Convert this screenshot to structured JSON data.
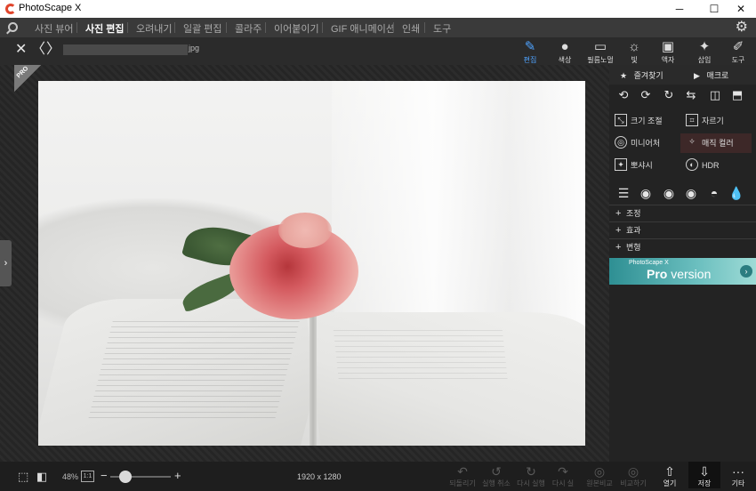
{
  "window": {
    "title": "PhotoScape X",
    "minimize": "─",
    "maximize": "☐",
    "close": "✕"
  },
  "menu": {
    "tabs": [
      "사진 뷰어",
      "사진 편집",
      "오려내기",
      "일괄 편집",
      "콜라주",
      "이어붙이기",
      "GIF 애니메이션",
      "인쇄",
      "도구"
    ],
    "active_index": 1
  },
  "nav": {
    "close": "✕",
    "prev": "〈",
    "next": "〉",
    "file_ext": "jpg"
  },
  "tools": [
    {
      "label": "편집",
      "icon": "edit-icon",
      "glyph": "✎",
      "active": true
    },
    {
      "label": "색상",
      "icon": "color-icon",
      "glyph": "●",
      "active": false
    },
    {
      "label": "필름노멀",
      "icon": "film-icon",
      "glyph": "▭",
      "active": false
    },
    {
      "label": "빛",
      "icon": "light-icon",
      "glyph": "☼",
      "active": false
    },
    {
      "label": "액자",
      "icon": "frame-icon",
      "glyph": "▣",
      "active": false
    },
    {
      "label": "삽입",
      "icon": "insert-icon",
      "glyph": "✦",
      "active": false
    },
    {
      "label": "도구",
      "icon": "tools-icon",
      "glyph": "✐",
      "active": false
    }
  ],
  "badge": "PRO",
  "sidebar": {
    "favorites": "즐겨찾기",
    "macro": "매크로",
    "transform_icons": [
      "rotate-left-icon",
      "rotate-right-icon",
      "rotate-arbitrary-icon",
      "straighten-icon",
      "flip-horizontal-icon",
      "flip-vertical-icon"
    ],
    "features": [
      {
        "label": "크기 조절",
        "icon": "resize-icon",
        "glyph": "⤡"
      },
      {
        "label": "자르기",
        "icon": "crop-icon",
        "glyph": "⌗"
      },
      {
        "label": "미니어처",
        "icon": "miniature-icon",
        "glyph": "◎"
      },
      {
        "label": "매직 컬러",
        "icon": "magic-wand-icon",
        "glyph": "✧"
      },
      {
        "label": "뽀샤시",
        "icon": "bloom-icon",
        "glyph": "✦"
      },
      {
        "label": "HDR",
        "icon": "hdr-icon",
        "glyph": "◐"
      }
    ],
    "filter_icons": [
      "list-icon",
      "filter-circle-1-icon",
      "filter-circle-2-icon",
      "filter-circle-3-icon",
      "half-circle-icon",
      "drop-icon"
    ],
    "sections": [
      "조정",
      "효과",
      "변형"
    ],
    "promo_small": "PhotoScape X",
    "promo_pro": "Pro",
    "promo_version": "version"
  },
  "bottom": {
    "zoom": "48%",
    "fit_label": "1:1",
    "zoom_minus": "−",
    "zoom_plus": "+",
    "zoom_value": 0.25,
    "dimensions": "1920 x 1280",
    "actions": [
      {
        "label": "되돌리기",
        "glyph": "↶",
        "enabled": false
      },
      {
        "label": "실행 취소",
        "glyph": "↺",
        "enabled": false
      },
      {
        "label": "다시 실행",
        "glyph": "↻",
        "enabled": false
      },
      {
        "label": "다시 실",
        "glyph": "↷",
        "enabled": false
      },
      {
        "label": "원본비교",
        "glyph": "◎",
        "enabled": false
      },
      {
        "label": "비교하기",
        "glyph": "◎",
        "enabled": false
      },
      {
        "label": "열기",
        "glyph": "⇧",
        "enabled": true
      },
      {
        "label": "저장",
        "glyph": "⇩",
        "enabled": true
      },
      {
        "label": "기타",
        "glyph": "···",
        "enabled": true
      }
    ]
  }
}
